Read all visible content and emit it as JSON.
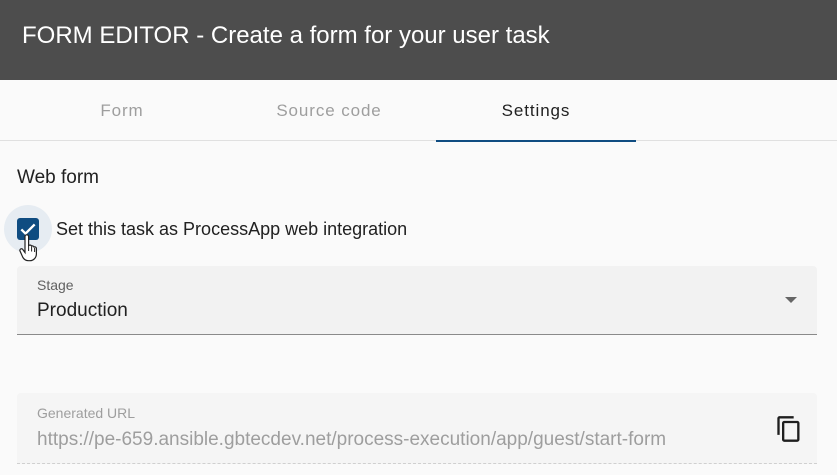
{
  "header": {
    "title": "FORM EDITOR - Create a form for your user task"
  },
  "tabs": [
    {
      "label": "Form",
      "active": false
    },
    {
      "label": "Source code",
      "active": false
    },
    {
      "label": "Settings",
      "active": true
    }
  ],
  "web_form": {
    "title": "Web form",
    "checkbox_label": "Set this task as ProcessApp web integration",
    "checked": true
  },
  "stage": {
    "label": "Stage",
    "value": "Production"
  },
  "generated_url": {
    "label": "Generated URL",
    "value": "https://pe-659.ansible.gbtecdev.net/process-execution/app/guest/start-form"
  },
  "icons": {
    "checkbox": "check-icon",
    "cursor": "hand-pointer-icon",
    "dropdown": "arrow-drop-down-icon",
    "copy": "copy-icon"
  },
  "colors": {
    "header_bg": "#4d4d4d",
    "accent": "#0f4c81"
  }
}
